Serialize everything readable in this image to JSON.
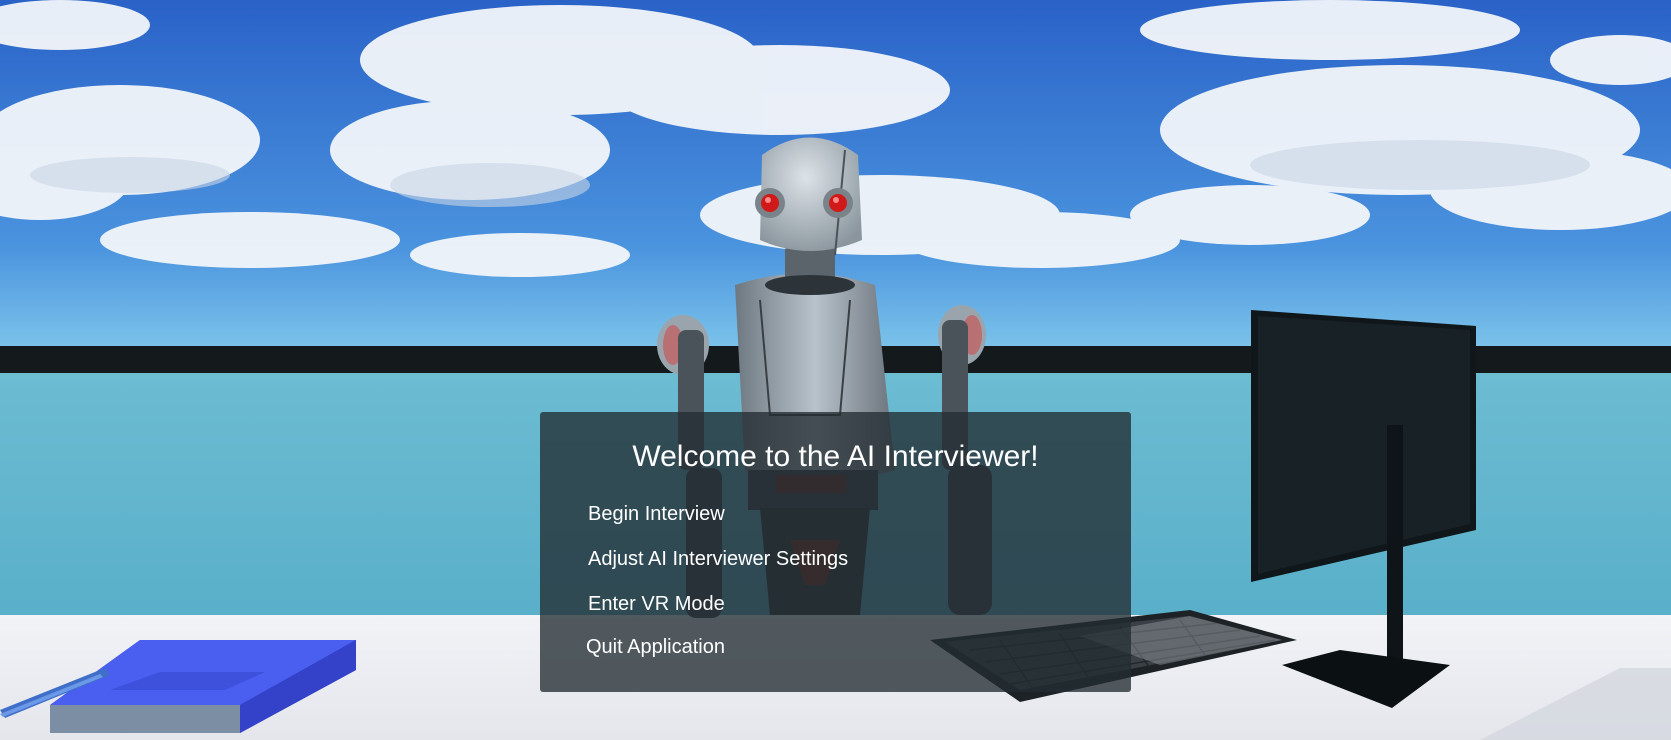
{
  "menu": {
    "title": "Welcome to the AI Interviewer!",
    "items": [
      {
        "label": "Begin Interview"
      },
      {
        "label": "Adjust AI Interviewer Settings"
      },
      {
        "label": "Enter VR Mode"
      },
      {
        "label": "Quit Application"
      }
    ]
  },
  "scene": {
    "objects": [
      "sky-with-clouds",
      "robot-interviewer",
      "computer-monitor",
      "keyboard",
      "book",
      "pen",
      "desk",
      "wall"
    ],
    "colors": {
      "sky": "#2f6fd0",
      "wall": "#5bb3cc",
      "rail": "#14191c",
      "desk": "#eef0f4",
      "book": "#4a5ff0",
      "robot_eye": "#d01a1a",
      "panel": "#23303a"
    }
  }
}
